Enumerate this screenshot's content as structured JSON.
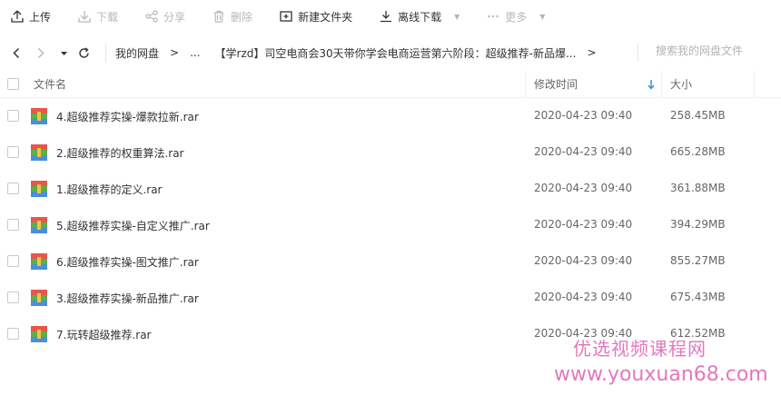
{
  "toolbar": {
    "upload": "上传",
    "download": "下载",
    "share": "分享",
    "delete": "删除",
    "new_folder": "新建文件夹",
    "offline_download": "离线下载",
    "more": "更多"
  },
  "nav": {
    "crumb_root": "我的网盘",
    "crumb_ellipsis": "...",
    "crumb_current": "【学rzd】司空电商会30天带你学会电商运营第六阶段：超级推荐-新品爆...",
    "sep": ">",
    "search_placeholder": "搜索我的网盘文件"
  },
  "table": {
    "headers": {
      "name": "文件名",
      "time": "修改时间",
      "size": "大小"
    },
    "rows": [
      {
        "name": "4.超级推荐实操-爆款拉新.rar",
        "time": "2020-04-23 09:40",
        "size": "258.45MB"
      },
      {
        "name": "2.超级推荐的权重算法.rar",
        "time": "2020-04-23 09:40",
        "size": "665.28MB"
      },
      {
        "name": "1.超级推荐的定义.rar",
        "time": "2020-04-23 09:40",
        "size": "361.88MB"
      },
      {
        "name": "5.超级推荐实操-自定义推广.rar",
        "time": "2020-04-23 09:40",
        "size": "394.29MB"
      },
      {
        "name": "6.超级推荐实操-图文推广.rar",
        "time": "2020-04-23 09:40",
        "size": "855.27MB"
      },
      {
        "name": "3.超级推荐实操-新品推广.rar",
        "time": "2020-04-23 09:40",
        "size": "675.43MB"
      },
      {
        "name": "7.玩转超级推荐.rar",
        "time": "2020-04-23 09:40",
        "size": "612.52MB"
      }
    ]
  },
  "watermark": {
    "line1": "优选视频课程网",
    "line2": "www.youxuan68.com"
  }
}
